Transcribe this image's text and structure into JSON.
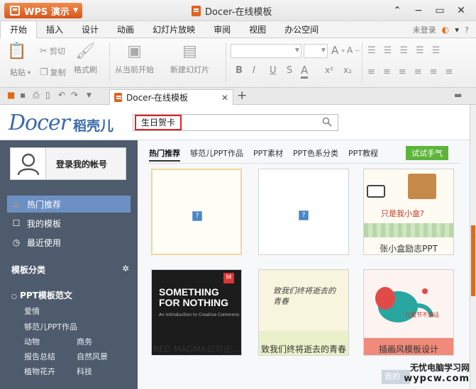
{
  "app": {
    "button_label": "WPS 演示",
    "window_title": "Docer-在线模板"
  },
  "menu": {
    "items": [
      "开始",
      "插入",
      "设计",
      "动画",
      "幻灯片放映",
      "审阅",
      "视图",
      "办公空间"
    ],
    "active_index": 0,
    "login_status": "未登录",
    "help": "?"
  },
  "ribbon": {
    "paste": "粘贴",
    "cut": "剪切",
    "copy": "复制",
    "format_painter": "格式刷",
    "from_current": "从当前开始",
    "new_slide": "新建幻灯片",
    "bold": "B",
    "italic": "I",
    "underline": "U",
    "strike": "S",
    "font_color": "A",
    "superscript": "x²",
    "subscript": "x₂",
    "grow_font": "A",
    "shrink_font": "A"
  },
  "doc_tab": {
    "label": "Docer-在线模板",
    "new_tab": "+"
  },
  "docer": {
    "brand": "Docer",
    "brand_cn": "稻壳儿",
    "search_value": "生日贺卡"
  },
  "sidebar": {
    "login_label": "登录我的帐号",
    "nav": [
      {
        "label": "热门推荐",
        "icon": "flame-icon"
      },
      {
        "label": "我的模板",
        "icon": "bookmark-icon"
      },
      {
        "label": "最近使用",
        "icon": "clock-icon"
      }
    ],
    "category_title": "模板分类",
    "category_sub": "PPT模板范文",
    "category_links": [
      "爱情",
      "够范儿PPT作品",
      "动物",
      "商务",
      "报告总结",
      "自然风景",
      "植物花卉",
      "科技"
    ]
  },
  "content": {
    "tabs": [
      "热门推荐",
      "够范儿PPT作品",
      "PPT素材",
      "PPT色系分类",
      "PPT教程"
    ],
    "try_button": "试试手气",
    "cards": [
      {
        "caption": ""
      },
      {
        "caption": ""
      },
      {
        "caption": "张小盒励志PPT",
        "thumb_text": "只是我小盒?"
      },
      {
        "caption": "RED MAGMA公司出...",
        "thumb_text": "SOMETHING FOR NOTHING",
        "thumb_sub": "An Introduction to Creative Commons"
      },
      {
        "caption": "致我们终将逝去的青春",
        "thumb_text": "致我们终将逝去的青春"
      },
      {
        "caption": "插画风模板设计",
        "thumb_text": "儿童节不放话"
      }
    ],
    "bottom_button": "我的"
  },
  "watermark": {
    "line1": "无忧电脑学习网",
    "line2": "wypcw.com"
  },
  "colors": {
    "wps_orange": "#d8561c",
    "sidebar_bg": "#4e5b6c",
    "sidebar_active": "#6c8fc4",
    "try_button_green": "#5db43a",
    "search_highlight": "#dd2222"
  }
}
